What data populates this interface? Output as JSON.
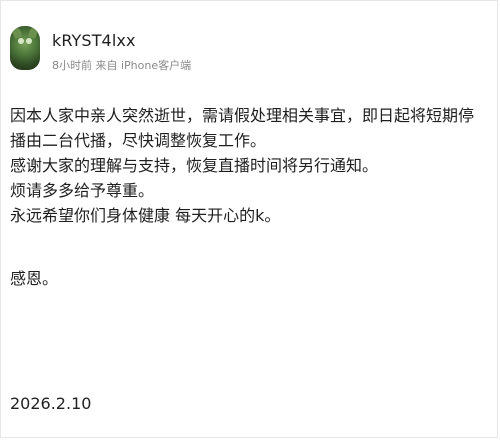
{
  "header": {
    "username": "kRYST4lxx",
    "meta": "8小时前 来自 iPhone客户端"
  },
  "post": {
    "lines": [
      "因本人家中亲人突然逝世，需请假处理相关事宜，即日起将短期停播由二台代播，尽快调整恢复工作。",
      "感谢大家的理解与支持，恢复直播时间将另行通知。",
      "烦请多多给予尊重。",
      "永远希望你们身体健康 每天开心的k。"
    ],
    "closing": "感恩。",
    "date": "2026.2.10"
  }
}
